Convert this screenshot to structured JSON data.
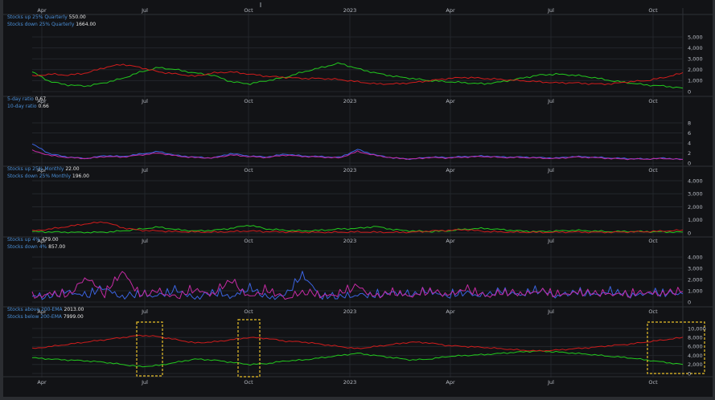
{
  "months": [
    "Apr",
    "Jul",
    "Oct",
    "2023",
    "Apr",
    "Jul",
    "Oct"
  ],
  "colors": {
    "green": "#22c81e",
    "red": "#d01c1c",
    "blue": "#3b63e0",
    "magenta": "#c42aa3",
    "highlight": "#e8c02a"
  },
  "chart_data": [
    {
      "type": "line",
      "x": [
        "Apr",
        "Jul",
        "Oct",
        "2023",
        "Apr",
        "Jul",
        "Oct"
      ],
      "ylim": [
        0,
        5000
      ],
      "yticks": [
        "0",
        "1,000",
        "2,000",
        "3,000",
        "4,000",
        "5,000"
      ],
      "series": [
        {
          "name": "Stocks up 25% Quarterly",
          "last": "550.00",
          "color": "green",
          "values": [
            1800,
            900,
            600,
            500,
            800,
            1200,
            1800,
            2200,
            2000,
            1700,
            1500,
            900,
            700,
            1000,
            1300,
            1800,
            2200,
            2600,
            2100,
            1700,
            1400,
            1200,
            1000,
            900,
            800,
            700,
            900,
            1200,
            1500,
            1600,
            1500,
            1300,
            1000,
            800,
            600,
            500,
            300
          ]
        },
        {
          "name": "Stocks down 25% Quarterly",
          "last": "1664.00",
          "color": "red",
          "values": [
            1400,
            1600,
            1500,
            1700,
            2200,
            2500,
            2200,
            1800,
            1600,
            1400,
            1700,
            1800,
            1600,
            1400,
            1300,
            1200,
            1200,
            1100,
            900,
            700,
            700,
            800,
            1000,
            1200,
            1300,
            1200,
            1100,
            1000,
            900,
            800,
            800,
            700,
            700,
            900,
            1000,
            1300,
            1700
          ]
        }
      ]
    },
    {
      "type": "line",
      "x": [
        "Apr",
        "Jul",
        "Oct",
        "2023",
        "Apr",
        "Jul",
        "Oct"
      ],
      "ylim": [
        0,
        8
      ],
      "yticks": [
        "0",
        "2",
        "4",
        "6",
        "8"
      ],
      "series": [
        {
          "name": "5-day ratio",
          "last": "0.67",
          "color": "blue",
          "values": [
            3.8,
            1.8,
            1.2,
            0.9,
            1.5,
            1.3,
            1.8,
            2.3,
            1.5,
            1.2,
            1.0,
            1.9,
            1.4,
            1.2,
            1.8,
            1.4,
            1.3,
            1.1,
            2.7,
            1.6,
            1.0,
            0.8,
            1.2,
            1.1,
            1.3,
            1.4,
            1.2,
            1.2,
            1.1,
            1.0,
            1.3,
            1.2,
            1.0,
            0.9,
            0.8,
            1.0,
            0.7
          ]
        },
        {
          "name": "10-day ratio",
          "last": "0.66",
          "color": "magenta",
          "values": [
            2.5,
            1.5,
            1.1,
            0.9,
            1.3,
            1.2,
            1.6,
            2.0,
            1.4,
            1.1,
            1.0,
            1.6,
            1.3,
            1.1,
            1.6,
            1.3,
            1.2,
            1.0,
            2.3,
            1.5,
            1.0,
            0.8,
            1.1,
            1.0,
            1.2,
            1.3,
            1.1,
            1.1,
            1.0,
            0.9,
            1.2,
            1.1,
            0.9,
            0.8,
            0.8,
            0.9,
            0.7
          ]
        }
      ]
    },
    {
      "type": "line",
      "x": [
        "Apr",
        "Jul",
        "Oct",
        "2023",
        "Apr",
        "Jul",
        "Oct"
      ],
      "ylim": [
        0,
        4000
      ],
      "yticks": [
        "0",
        "1,000",
        "2,000",
        "3,000",
        "4,000"
      ],
      "series": [
        {
          "name": "Stocks up 25% Monthly",
          "last": "22.00",
          "color": "green",
          "values": [
            100,
            80,
            50,
            40,
            60,
            150,
            300,
            450,
            250,
            150,
            200,
            350,
            600,
            300,
            200,
            150,
            200,
            300,
            350,
            500,
            250,
            150,
            100,
            150,
            300,
            350,
            250,
            150,
            100,
            150,
            200,
            150,
            100,
            120,
            100,
            80,
            60
          ]
        },
        {
          "name": "Stocks down 25% Monthly",
          "last": "196.00",
          "color": "red",
          "values": [
            150,
            300,
            500,
            700,
            850,
            400,
            200,
            150,
            100,
            80,
            60,
            100,
            150,
            100,
            80,
            60,
            50,
            60,
            80,
            60,
            50,
            60,
            150,
            200,
            250,
            120,
            80,
            60,
            50,
            60,
            80,
            60,
            50,
            80,
            100,
            150,
            200
          ]
        }
      ]
    },
    {
      "type": "line",
      "x": [
        "Apr",
        "Jul",
        "Oct",
        "2023",
        "Apr",
        "Jul",
        "Oct"
      ],
      "ylim": [
        0,
        4000
      ],
      "yticks": [
        "0",
        "1,000",
        "2,000",
        "3,000",
        "4,000"
      ],
      "series": [
        {
          "name": "Stocks up 4%",
          "last": "479.00",
          "color": "blue",
          "values": [
            500,
            300,
            900,
            400,
            1200,
            300,
            600,
            500,
            900,
            300,
            700,
            400,
            1100,
            300,
            500,
            2300,
            400,
            300,
            600,
            400,
            800,
            500,
            900,
            400,
            700,
            500,
            800,
            600,
            900,
            500,
            700,
            600,
            800,
            500,
            700,
            600,
            800
          ]
        },
        {
          "name": "Stocks down 4%",
          "last": "857.00",
          "color": "magenta",
          "values": [
            300,
            700,
            400,
            2200,
            500,
            2700,
            400,
            900,
            300,
            1000,
            600,
            1800,
            400,
            900,
            300,
            700,
            500,
            600,
            1300,
            400,
            700,
            500,
            800,
            600,
            1000,
            500,
            700,
            600,
            900,
            500,
            800,
            600,
            700,
            500,
            800,
            600,
            900
          ]
        }
      ]
    },
    {
      "type": "line",
      "x": [
        "Apr",
        "Jul",
        "Oct",
        "2023",
        "Apr",
        "Jul",
        "Oct"
      ],
      "ylim": [
        0,
        10000
      ],
      "yticks": [
        "0",
        "2,000",
        "4,000",
        "6,000",
        "8,000",
        "10,000"
      ],
      "series": [
        {
          "name": "Stocks above 200-EMA",
          "last": "2013.00",
          "color": "green",
          "values": [
            3500,
            3200,
            3000,
            2800,
            2500,
            2000,
            1500,
            1800,
            2500,
            3200,
            3000,
            2500,
            2000,
            2200,
            2800,
            3000,
            3500,
            4000,
            4500,
            4000,
            3500,
            3000,
            3200,
            3800,
            4000,
            4200,
            4500,
            4800,
            5000,
            4800,
            4500,
            4200,
            3800,
            3500,
            3000,
            2500,
            2000
          ]
        },
        {
          "name": "Stocks below 200-EMA",
          "last": "7999.00",
          "color": "red",
          "values": [
            5500,
            6000,
            6500,
            7000,
            7500,
            8000,
            8500,
            8200,
            7500,
            6800,
            7000,
            7500,
            8000,
            7800,
            7200,
            7000,
            6500,
            6000,
            5500,
            6000,
            6500,
            7000,
            6800,
            6200,
            6000,
            5800,
            5500,
            5200,
            5000,
            5200,
            5500,
            5800,
            6200,
            6500,
            7000,
            7500,
            8000
          ]
        }
      ]
    }
  ]
}
